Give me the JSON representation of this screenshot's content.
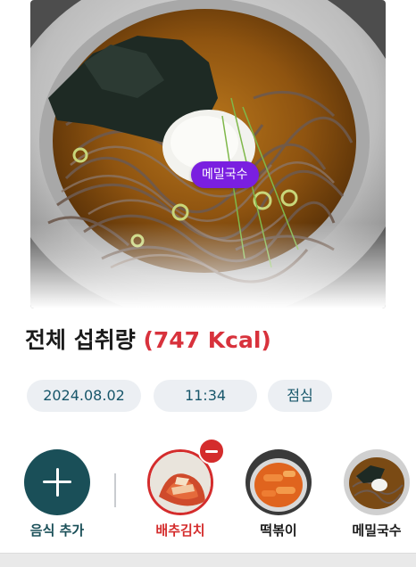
{
  "photo": {
    "tag_label": "메밀국수"
  },
  "summary": {
    "title": "전체 섭취량",
    "kcal": "(747 Kcal)"
  },
  "meta": {
    "date": "2024.08.02",
    "time": "11:34",
    "meal_type": "점심"
  },
  "foods": {
    "add_label": "음식 추가",
    "items": [
      {
        "label": "배추김치",
        "selected": true
      },
      {
        "label": "떡볶이",
        "selected": false
      },
      {
        "label": "메밀국수",
        "selected": false
      }
    ]
  },
  "colors": {
    "accent_teal": "#1a4f58",
    "accent_red": "#d42c2c",
    "tag_purple": "#7a1fe0",
    "kcal_red": "#d8323c"
  }
}
